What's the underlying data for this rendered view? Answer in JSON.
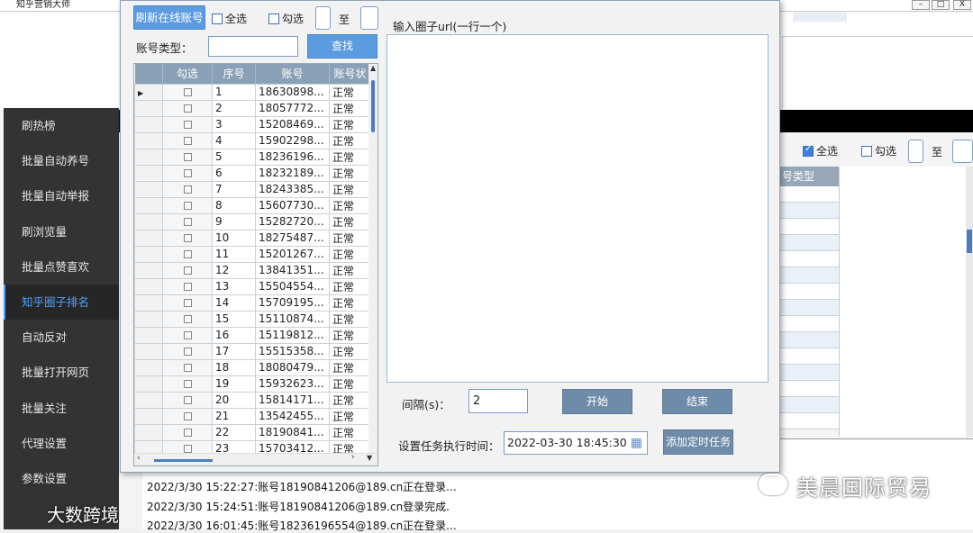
{
  "main_window": {
    "title": "知乎营销大师",
    "controls": {
      "minimize": "–",
      "maximize": "□",
      "close": "X"
    }
  },
  "sidebar": {
    "items": [
      {
        "label": "刷热榜",
        "active": false
      },
      {
        "label": "批量自动养号",
        "active": false
      },
      {
        "label": "批量自动举报",
        "active": false
      },
      {
        "label": "刷浏览量",
        "active": false
      },
      {
        "label": "批量点赞喜欢",
        "active": false
      },
      {
        "label": "知乎圈子排名",
        "active": true
      },
      {
        "label": "自动反对",
        "active": false
      },
      {
        "label": "批量打开网页",
        "active": false
      },
      {
        "label": "批量关注",
        "active": false
      },
      {
        "label": "代理设置",
        "active": false
      },
      {
        "label": "参数设置",
        "active": false
      }
    ]
  },
  "bg_panel": {
    "select_all_label": "全选",
    "select_all_checked": true,
    "check_label": "勾选",
    "to_label": "至",
    "col_header": "号类型"
  },
  "dialog": {
    "refresh_button": "刷新在线账号",
    "select_all_label": "全选",
    "check_label": "勾选",
    "to_label": "至",
    "account_type_label": "账号类型：",
    "account_type_value": "",
    "search_button": "查找",
    "table": {
      "headers": [
        "勾选",
        "序号",
        "账号",
        "账号状"
      ],
      "rows": [
        [
          "1",
          "18630898...",
          "正常"
        ],
        [
          "2",
          "18057772...",
          "正常"
        ],
        [
          "3",
          "15208469...",
          "正常"
        ],
        [
          "4",
          "15902298...",
          "正常"
        ],
        [
          "5",
          "18236196...",
          "正常"
        ],
        [
          "6",
          "18232189...",
          "正常"
        ],
        [
          "7",
          "18243385...",
          "正常"
        ],
        [
          "8",
          "15607730...",
          "正常"
        ],
        [
          "9",
          "15282720...",
          "正常"
        ],
        [
          "10",
          "18275487...",
          "正常"
        ],
        [
          "11",
          "15201267...",
          "正常"
        ],
        [
          "12",
          "13841351...",
          "正常"
        ],
        [
          "13",
          "15504554...",
          "正常"
        ],
        [
          "14",
          "15709195...",
          "正常"
        ],
        [
          "15",
          "15110874...",
          "正常"
        ],
        [
          "16",
          "15119812...",
          "正常"
        ],
        [
          "17",
          "15515358...",
          "正常"
        ],
        [
          "18",
          "18080479...",
          "正常"
        ],
        [
          "19",
          "15932623...",
          "正常"
        ],
        [
          "20",
          "15814171...",
          "正常"
        ],
        [
          "21",
          "13542455...",
          "正常"
        ],
        [
          "22",
          "18190841...",
          "正常"
        ],
        [
          "23",
          "15703412...",
          "正常"
        ]
      ]
    },
    "url_label": "输入圈子url(一行一个)",
    "url_value": "",
    "interval_label": "间隔(s)：",
    "interval_value": "2",
    "start_button": "开始",
    "stop_button": "结束",
    "schedule_label": "设置任务执行时间：",
    "schedule_value": "2022-03-30 18:45:30",
    "calendar_icon": "calendar-icon",
    "add_schedule_button": "添加定时任务"
  },
  "log": {
    "lines": [
      "2022/3/30 15:22:27:账号18190841206@189.cn正在登录...",
      "2022/3/30 15:24:51:账号18190841206@189.cn登录完成.",
      "2022/3/30 16:01:45:账号18236196554@189.cn正在登录..."
    ]
  },
  "watermarks": {
    "right": "美晨国际贸易",
    "bottom_left": "大数跨境"
  },
  "colors": {
    "sidebar_bg": "#333333",
    "sidebar_active_text": "#4ea1ff",
    "button_blue": "#5b9be0",
    "button_slate": "#6e8ba9",
    "grid_header": "#8aa0b7"
  }
}
